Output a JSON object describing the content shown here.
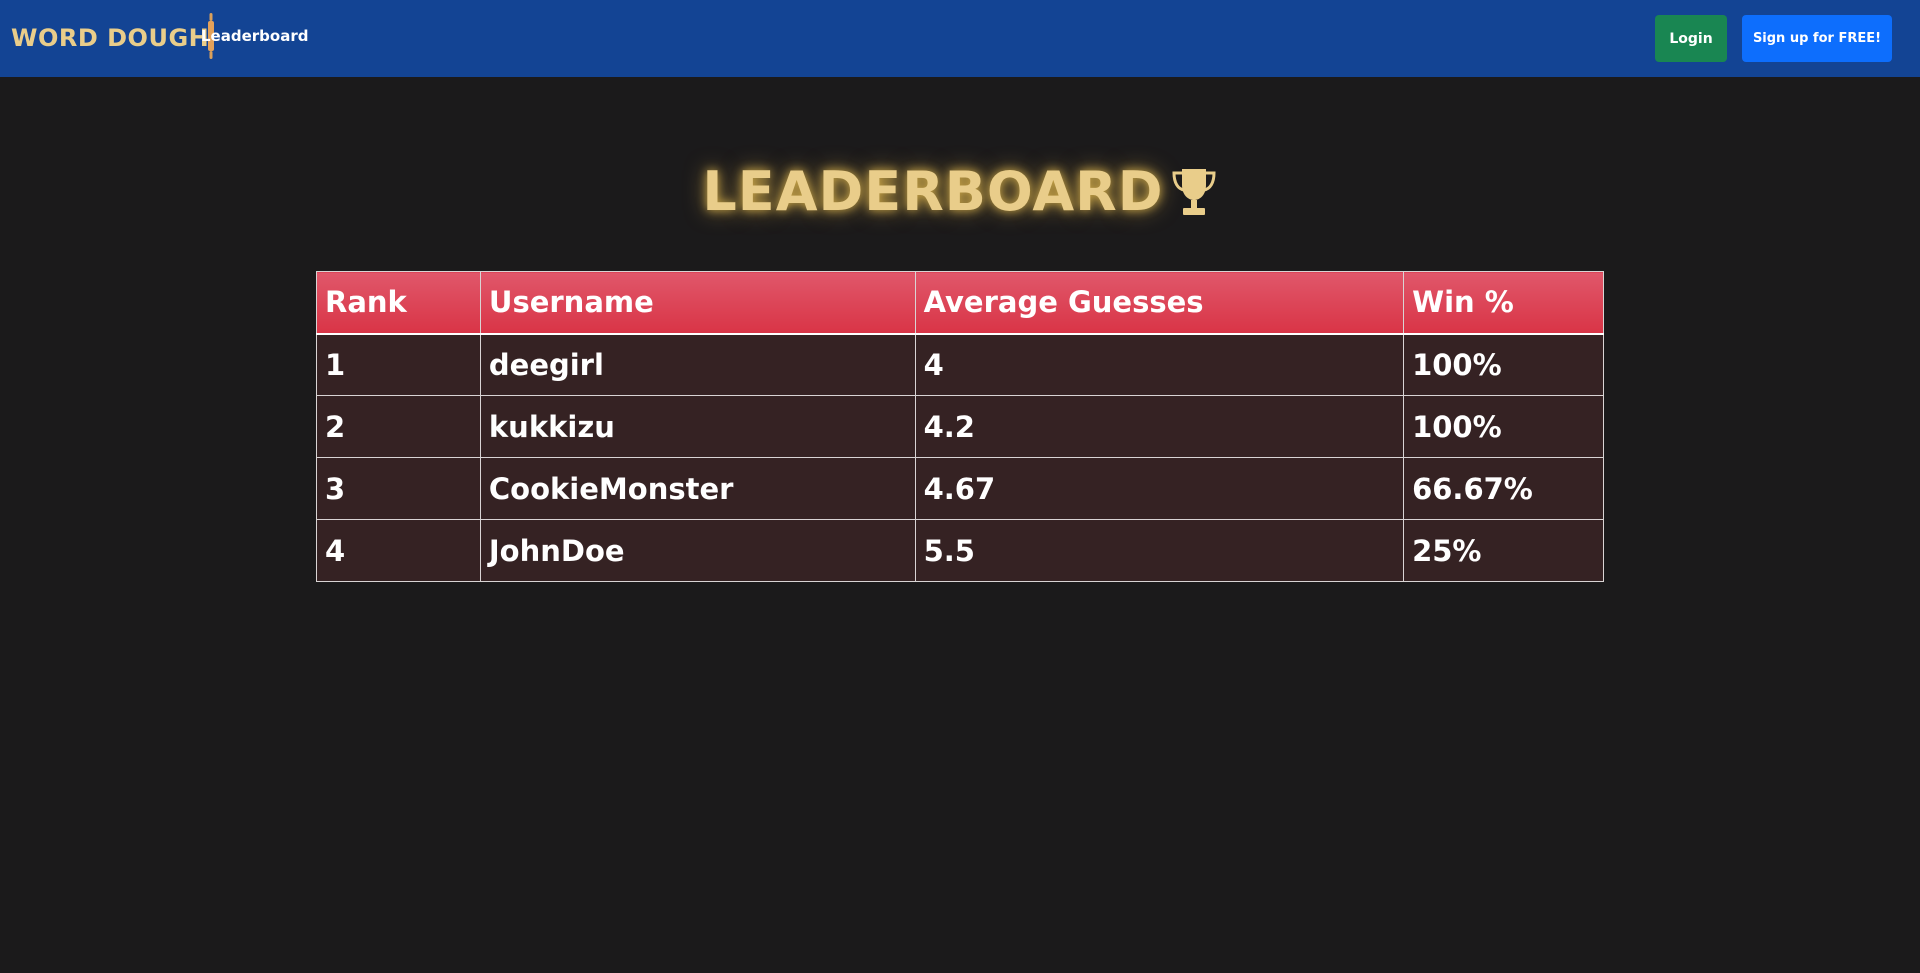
{
  "nav": {
    "brand": "WORD DOUGH",
    "links": [
      {
        "label": "Leaderboard"
      }
    ],
    "login_label": "Login",
    "signup_label": "Sign up for FREE!"
  },
  "page": {
    "title": "LEADERBOARD"
  },
  "table": {
    "headers": [
      "Rank",
      "Username",
      "Average Guesses",
      "Win %"
    ],
    "rows": [
      [
        "1",
        "deegirl",
        "4",
        "100%"
      ],
      [
        "2",
        "kukkizu",
        "4.2",
        "100%"
      ],
      [
        "3",
        "CookieMonster",
        "4.67",
        "66.67%"
      ],
      [
        "4",
        "JohnDoe",
        "5.5",
        "25%"
      ]
    ]
  },
  "colors": {
    "navbar": "#134494",
    "brand": "#e9cd8a",
    "login": "#198652",
    "signup": "#0d6efd",
    "header_row": "#d93446",
    "body_row": "#352223",
    "background": "#1b1a1b"
  },
  "icons": {
    "brand": "rolling-pin-icon",
    "title": "trophy-icon"
  }
}
